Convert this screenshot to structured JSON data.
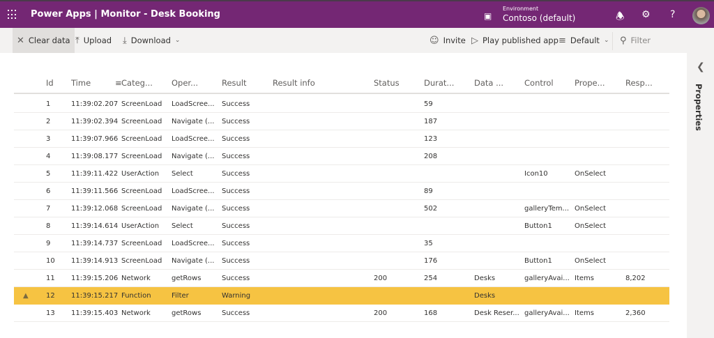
{
  "header": {
    "app": "Power Apps",
    "separator": "|",
    "title": "Monitor - Desk Booking",
    "environment_label": "Environment",
    "environment_value": "Contoso (default)"
  },
  "toolbar": {
    "clear": "Clear data",
    "upload": "Upload",
    "download": "Download",
    "invite": "Invite",
    "play": "Play published app",
    "view": "Default",
    "filter": "Filter"
  },
  "side_panel": {
    "label": "Properties"
  },
  "columns": [
    "Id",
    "Time",
    "Categ...",
    "Oper...",
    "Result",
    "Result info",
    "Status",
    "Durat...",
    "Data ...",
    "Control",
    "Prope...",
    "Resp..."
  ],
  "rows": [
    {
      "id": "1",
      "time": "11:39:02.207",
      "category": "ScreenLoad",
      "operation": "LoadScree...",
      "result": "Success",
      "result_info": "",
      "status": "",
      "duration": "59",
      "data": "",
      "control": "",
      "property": "",
      "response": ""
    },
    {
      "id": "2",
      "time": "11:39:02.394",
      "category": "ScreenLoad",
      "operation": "Navigate (...",
      "result": "Success",
      "result_info": "",
      "status": "",
      "duration": "187",
      "data": "",
      "control": "",
      "property": "",
      "response": ""
    },
    {
      "id": "3",
      "time": "11:39:07.966",
      "category": "ScreenLoad",
      "operation": "LoadScree...",
      "result": "Success",
      "result_info": "",
      "status": "",
      "duration": "123",
      "data": "",
      "control": "",
      "property": "",
      "response": ""
    },
    {
      "id": "4",
      "time": "11:39:08.177",
      "category": "ScreenLoad",
      "operation": "Navigate (...",
      "result": "Success",
      "result_info": "",
      "status": "",
      "duration": "208",
      "data": "",
      "control": "",
      "property": "",
      "response": ""
    },
    {
      "id": "5",
      "time": "11:39:11.422",
      "category": "UserAction",
      "operation": "Select",
      "result": "Success",
      "result_info": "",
      "status": "",
      "duration": "",
      "data": "",
      "control": "Icon10",
      "property": "OnSelect",
      "response": ""
    },
    {
      "id": "6",
      "time": "11:39:11.566",
      "category": "ScreenLoad",
      "operation": "LoadScree...",
      "result": "Success",
      "result_info": "",
      "status": "",
      "duration": "89",
      "data": "",
      "control": "",
      "property": "",
      "response": ""
    },
    {
      "id": "7",
      "time": "11:39:12.068",
      "category": "ScreenLoad",
      "operation": "Navigate (...",
      "result": "Success",
      "result_info": "",
      "status": "",
      "duration": "502",
      "data": "",
      "control": "galleryTem...",
      "property": "OnSelect",
      "response": ""
    },
    {
      "id": "8",
      "time": "11:39:14.614",
      "category": "UserAction",
      "operation": "Select",
      "result": "Success",
      "result_info": "",
      "status": "",
      "duration": "",
      "data": "",
      "control": "Button1",
      "property": "OnSelect",
      "response": ""
    },
    {
      "id": "9",
      "time": "11:39:14.737",
      "category": "ScreenLoad",
      "operation": "LoadScree...",
      "result": "Success",
      "result_info": "",
      "status": "",
      "duration": "35",
      "data": "",
      "control": "",
      "property": "",
      "response": ""
    },
    {
      "id": "10",
      "time": "11:39:14.913",
      "category": "ScreenLoad",
      "operation": "Navigate (...",
      "result": "Success",
      "result_info": "",
      "status": "",
      "duration": "176",
      "data": "",
      "control": "Button1",
      "property": "OnSelect",
      "response": ""
    },
    {
      "id": "11",
      "time": "11:39:15.206",
      "category": "Network",
      "operation": "getRows",
      "result": "Success",
      "result_info": "",
      "status": "200",
      "duration": "254",
      "data": "Desks",
      "control": "galleryAvai...",
      "property": "Items",
      "response": "8,202"
    },
    {
      "id": "12",
      "time": "11:39:15.217",
      "category": "Function",
      "operation": "Filter",
      "result": "Warning",
      "result_info": "",
      "status": "",
      "duration": "",
      "data": "Desks",
      "control": "",
      "property": "",
      "response": "",
      "warning": true
    },
    {
      "id": "13",
      "time": "11:39:15.403",
      "category": "Network",
      "operation": "getRows",
      "result": "Success",
      "result_info": "",
      "status": "200",
      "duration": "168",
      "data": "Desk Reser...",
      "control": "galleryAvai...",
      "property": "Items",
      "response": "2,360"
    }
  ],
  "colors": {
    "brand": "#742774",
    "warning_row": "#f6c342",
    "toolbar_bg": "#f3f2f1"
  }
}
